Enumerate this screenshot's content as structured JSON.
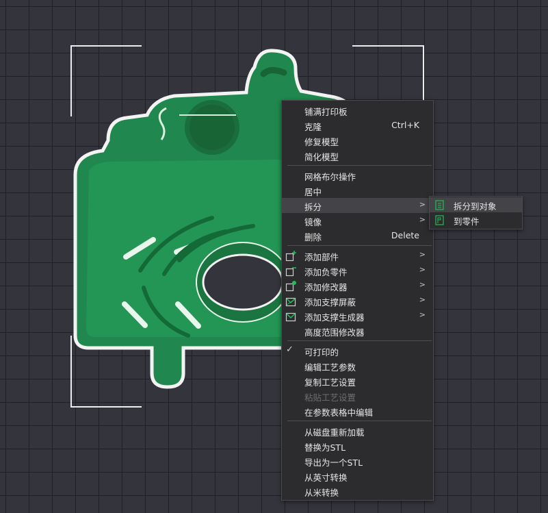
{
  "colors": {
    "model": "#20884e",
    "menu_bg": "#2c2c2e",
    "accent": "#1fbf57",
    "grid_bg": "#34343c"
  },
  "context_menu": {
    "items": [
      {
        "label": "铺满打印板"
      },
      {
        "label": "克隆",
        "shortcut": "Ctrl+K"
      },
      {
        "label": "修复模型"
      },
      {
        "label": "简化模型"
      },
      {
        "label": "网格布尔操作"
      },
      {
        "label": "居中"
      },
      {
        "label": "拆分",
        "submenu": true,
        "highlighted": true
      },
      {
        "label": "镜像",
        "submenu": true
      },
      {
        "label": "删除",
        "shortcut": "Delete"
      },
      {
        "label": "添加部件",
        "submenu": true,
        "icon": "add-part-icon"
      },
      {
        "label": "添加负零件",
        "submenu": true,
        "icon": "add-negative-part-icon"
      },
      {
        "label": "添加修改器",
        "submenu": true,
        "icon": "add-modifier-icon"
      },
      {
        "label": "添加支撑屏蔽",
        "submenu": true,
        "icon": "support-blocker-icon"
      },
      {
        "label": "添加支撑生成器",
        "submenu": true,
        "icon": "support-enforcer-icon"
      },
      {
        "label": "高度范围修改器"
      },
      {
        "label": "可打印的",
        "checked": true
      },
      {
        "label": "编辑工艺参数"
      },
      {
        "label": "复制工艺设置"
      },
      {
        "label": "粘贴工艺设置",
        "disabled": true
      },
      {
        "label": "在参数表格中编辑"
      },
      {
        "label": "从磁盘重新加载"
      },
      {
        "label": "替换为STL"
      },
      {
        "label": "导出为一个STL"
      },
      {
        "label": "从英寸转换"
      },
      {
        "label": "从米转换"
      }
    ]
  },
  "split_submenu": {
    "items": [
      {
        "label": "拆分到对象",
        "icon": "split-to-objects-icon"
      },
      {
        "label": "到零件",
        "icon": "split-to-parts-icon"
      }
    ]
  }
}
